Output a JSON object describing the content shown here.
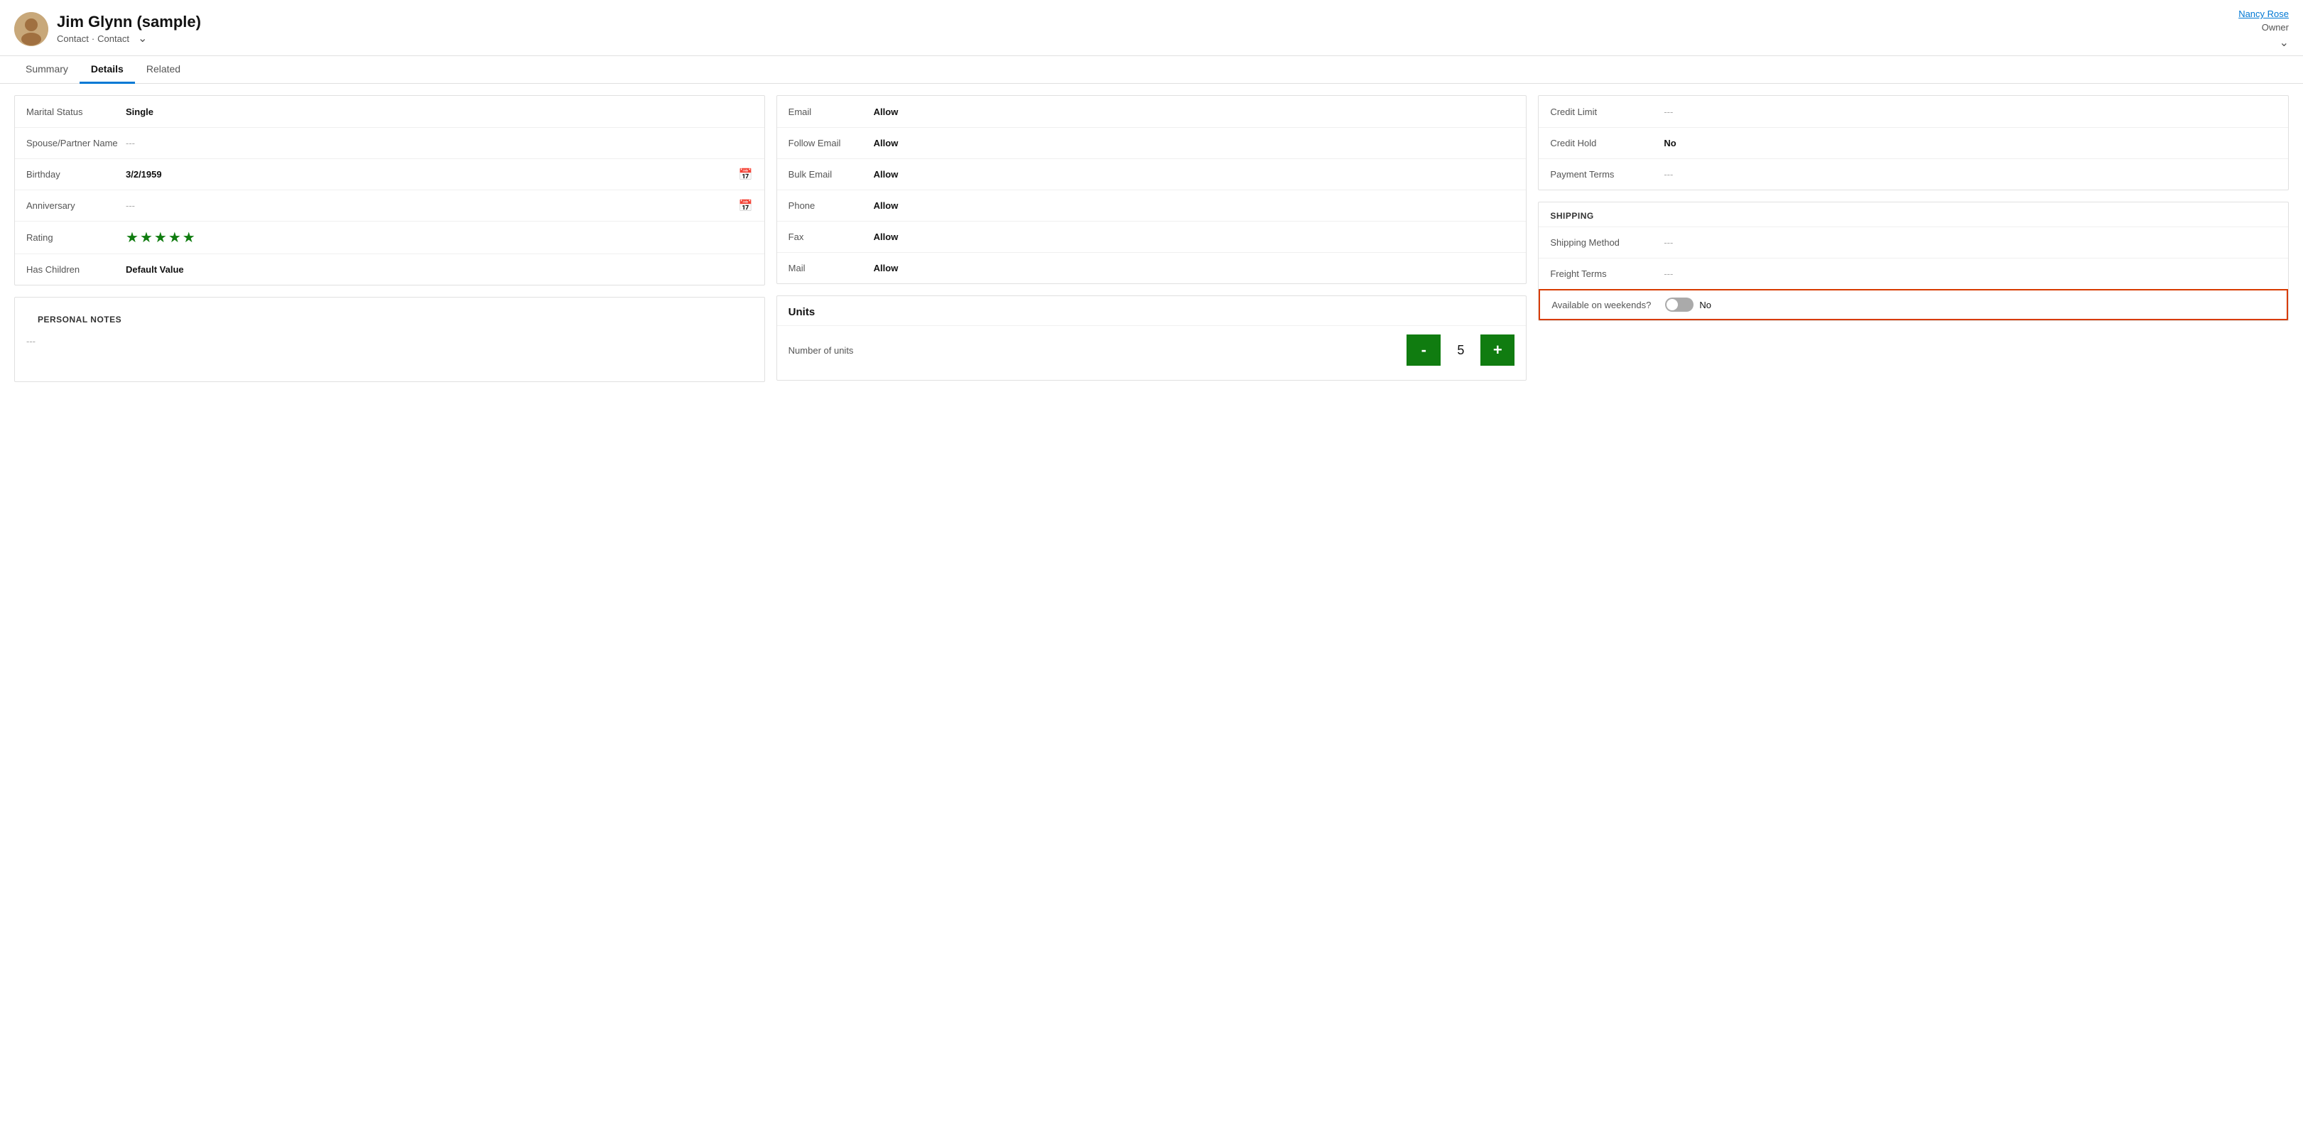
{
  "header": {
    "name": "Jim Glynn (sample)",
    "type1": "Contact",
    "type2": "Contact",
    "owner_label": "Owner",
    "owner_name": "Nancy Rose"
  },
  "tabs": [
    {
      "label": "Summary",
      "active": false
    },
    {
      "label": "Details",
      "active": true
    },
    {
      "label": "Related",
      "active": false
    }
  ],
  "left_column": {
    "personal_info": {
      "fields": [
        {
          "label": "Marital Status",
          "value": "Single",
          "type": "value"
        },
        {
          "label": "Spouse/Partner Name",
          "value": "---",
          "type": "empty"
        },
        {
          "label": "Birthday",
          "value": "3/2/1959",
          "type": "calendar"
        },
        {
          "label": "Anniversary",
          "value": "---",
          "type": "calendar_empty"
        },
        {
          "label": "Rating",
          "value": "5",
          "type": "stars"
        },
        {
          "label": "Has Children",
          "value": "Default Value",
          "type": "value"
        }
      ]
    },
    "personal_notes": {
      "title": "PERSONAL NOTES",
      "value": "---"
    }
  },
  "middle_column": {
    "contact_preferences": {
      "fields": [
        {
          "label": "Email",
          "value": "Allow"
        },
        {
          "label": "Follow Email",
          "value": "Allow"
        },
        {
          "label": "Bulk Email",
          "value": "Allow"
        },
        {
          "label": "Phone",
          "value": "Allow"
        },
        {
          "label": "Fax",
          "value": "Allow"
        },
        {
          "label": "Mail",
          "value": "Allow"
        }
      ]
    },
    "units": {
      "title": "Units",
      "field_label": "Number of units",
      "value": 5,
      "decrement_label": "-",
      "increment_label": "+"
    }
  },
  "right_column": {
    "billing": {
      "fields": [
        {
          "label": "Credit Limit",
          "value": "---",
          "type": "empty"
        },
        {
          "label": "Credit Hold",
          "value": "No",
          "type": "value"
        },
        {
          "label": "Payment Terms",
          "value": "---",
          "type": "empty"
        }
      ]
    },
    "shipping": {
      "title": "SHIPPING",
      "fields": [
        {
          "label": "Shipping Method",
          "value": "---",
          "type": "empty"
        },
        {
          "label": "Freight Terms",
          "value": "---",
          "type": "empty"
        }
      ],
      "weekend_field": {
        "label": "Available on weekends?",
        "value": "No",
        "toggled": false
      }
    }
  }
}
